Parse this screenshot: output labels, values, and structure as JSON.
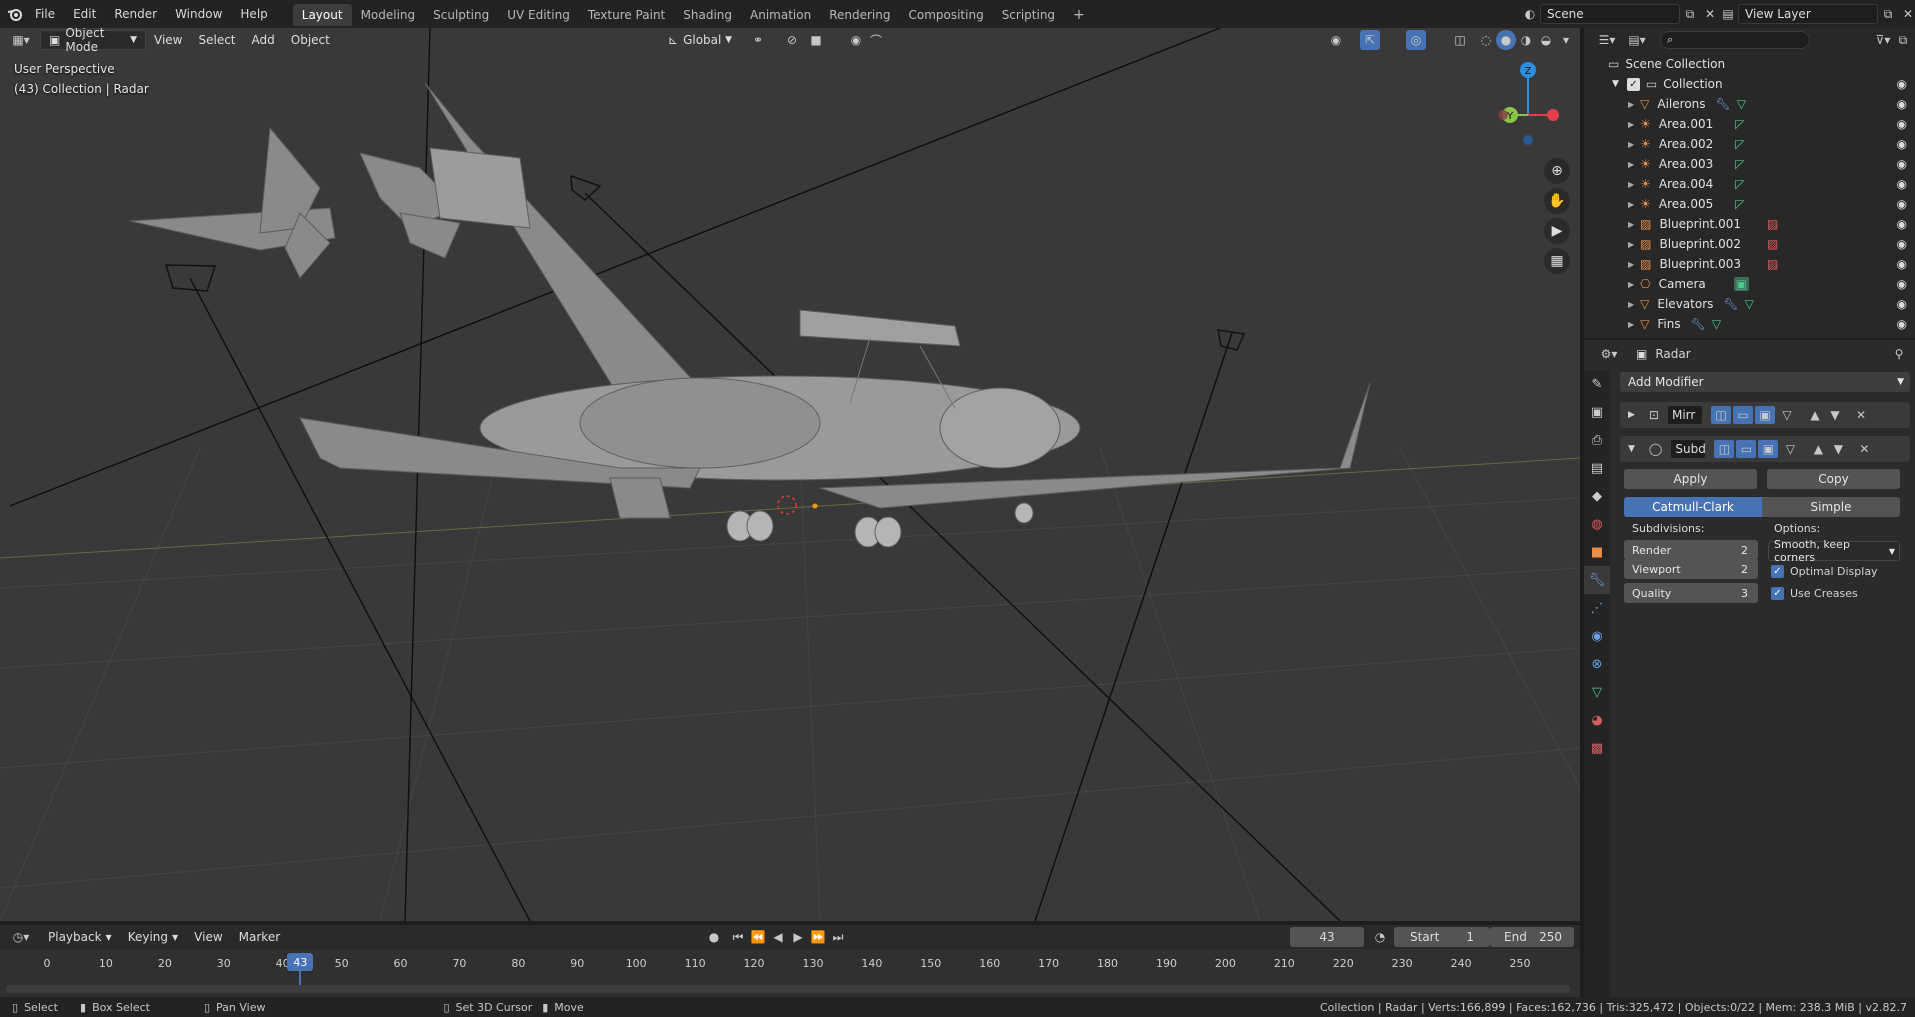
{
  "menu": {
    "file": "File",
    "edit": "Edit",
    "render": "Render",
    "window": "Window",
    "help": "Help"
  },
  "workspaces": [
    "Layout",
    "Modeling",
    "Sculpting",
    "UV Editing",
    "Texture Paint",
    "Shading",
    "Animation",
    "Rendering",
    "Compositing",
    "Scripting"
  ],
  "active_workspace": "Layout",
  "scene": {
    "name": "Scene",
    "view_layer": "View Layer"
  },
  "viewport": {
    "mode": "Object Mode",
    "view": "View",
    "select": "Select",
    "add": "Add",
    "object": "Object",
    "orientation": "Global",
    "perspective": "User Perspective",
    "collection_info": "(43) Collection | Radar",
    "axis_z": "Z",
    "axis_y": "Y"
  },
  "outliner": {
    "search_placeholder": "",
    "scene_collection": "Scene Collection",
    "collection": "Collection",
    "items": [
      "Ailerons",
      "Area.001",
      "Area.002",
      "Area.003",
      "Area.004",
      "Area.005",
      "Blueprint.001",
      "Blueprint.002",
      "Blueprint.003",
      "Camera",
      "Elevators",
      "Fins"
    ]
  },
  "properties": {
    "object_name": "Radar",
    "add_modifier": "Add Modifier",
    "mod1_name": "Mirr",
    "mod2_name": "Subd",
    "apply": "Apply",
    "copy": "Copy",
    "catmull": "Catmull-Clark",
    "simple": "Simple",
    "subdivisions": "Subdivisions:",
    "options": "Options:",
    "render_label": "Render",
    "render_val": "2",
    "viewport_label": "Viewport",
    "viewport_val": "2",
    "quality_label": "Quality",
    "quality_val": "3",
    "uv_smooth": "Smooth, keep corners",
    "optimal_display": "Optimal Display",
    "use_creases": "Use Creases"
  },
  "timeline": {
    "playback": "Playback",
    "keying": "Keying",
    "view": "View",
    "marker": "Marker",
    "current_frame": "43",
    "start_label": "Start",
    "start_val": "1",
    "end_label": "End",
    "end_val": "250",
    "ticks": [
      "0",
      "10",
      "20",
      "30",
      "40",
      "50",
      "60",
      "70",
      "80",
      "90",
      "100",
      "110",
      "120",
      "130",
      "140",
      "150",
      "160",
      "170",
      "180",
      "190",
      "200",
      "210",
      "220",
      "230",
      "240",
      "250"
    ],
    "frame_range": [
      0,
      250
    ]
  },
  "status": {
    "select": "Select",
    "box_select": "Box Select",
    "pan_view": "Pan View",
    "set_cursor": "Set 3D Cursor",
    "move": "Move",
    "info": "Collection | Radar | Verts:166,899 | Faces:162,736 | Tris:325,472 | Objects:0/22 | Mem: 238.3 MiB | v2.82.7"
  },
  "colors": {
    "accent": "#4772b3",
    "axis_x": "#e53e4b",
    "axis_y": "#8ac34a",
    "axis_z": "#2b8fe0",
    "active_frame": "#4772b3"
  }
}
